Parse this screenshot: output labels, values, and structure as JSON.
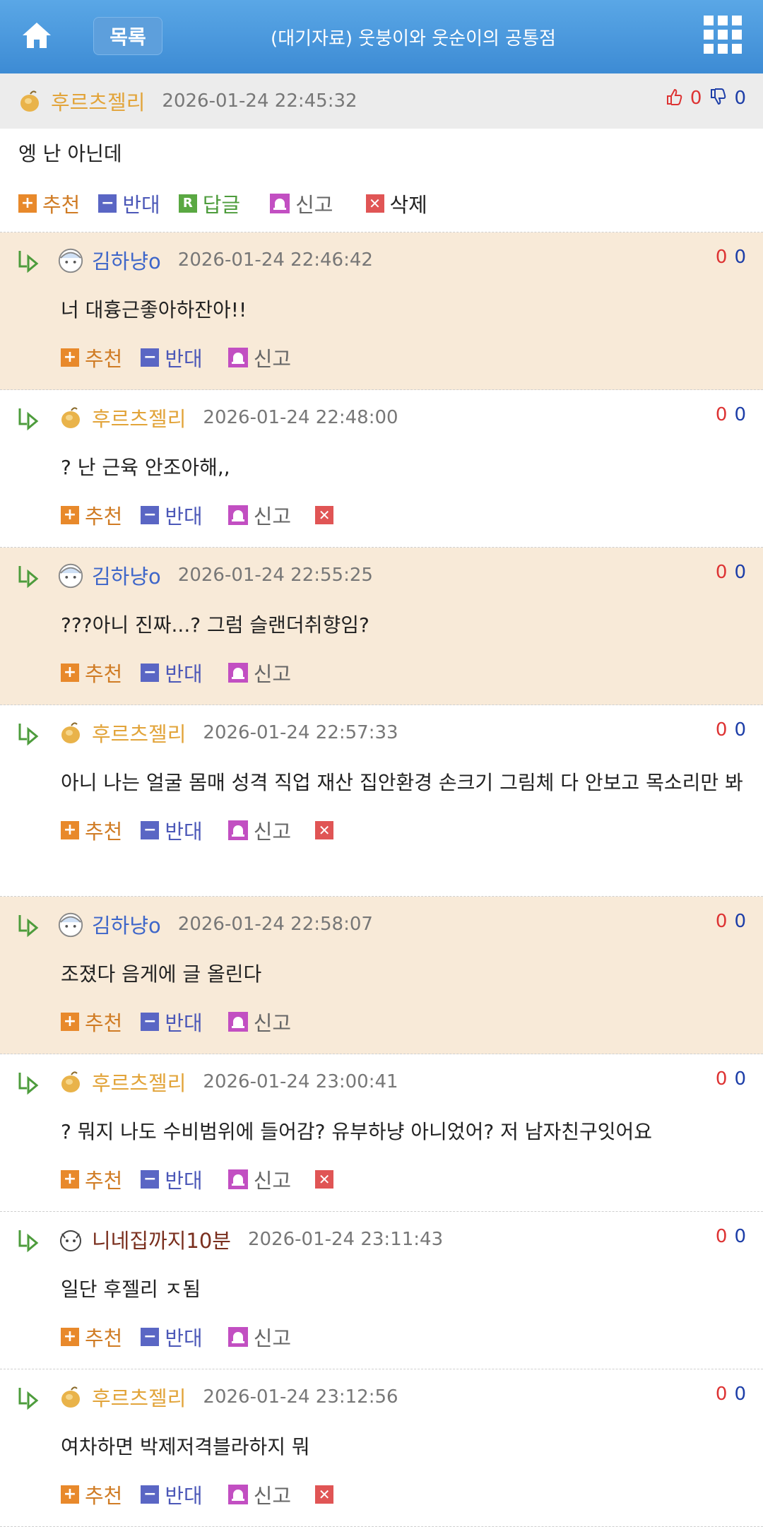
{
  "header": {
    "list_label": "목록",
    "title": "(대기자료) 웃붕이와 웃순이의 공통점"
  },
  "main_comment": {
    "nick": "후르츠젤리",
    "date": "2026-01-24 22:45:32",
    "up": "0",
    "down": "0",
    "text": "엥 난 아닌데",
    "actions": {
      "recommend": "추천",
      "oppose": "반대",
      "reply": "답글",
      "report": "신고",
      "delete": "삭제"
    }
  },
  "labels": {
    "recommend": "추천",
    "oppose": "반대",
    "report": "신고"
  },
  "replies": [
    {
      "nick": "김하냥o",
      "date": "2026-01-24 22:46:42",
      "up": "0",
      "down": "0",
      "text": "너 대흉근좋아하잔아!!"
    },
    {
      "nick": "후르츠젤리",
      "date": "2026-01-24 22:48:00",
      "up": "0",
      "down": "0",
      "text": "? 난 근육 안조아해,,"
    },
    {
      "nick": "김하냥o",
      "date": "2026-01-24 22:55:25",
      "up": "0",
      "down": "0",
      "text": "???아니 진짜...? 그럼 슬랜더취향임?"
    },
    {
      "nick": "후르츠젤리",
      "date": "2026-01-24 22:57:33",
      "up": "0",
      "down": "0",
      "text": "아니 나는 얼굴 몸매 성격 직업 재산 집안환경 손크기 그림체 다 안보고 목소리만 봐"
    },
    {
      "nick": "김하냥o",
      "date": "2026-01-24 22:58:07",
      "up": "0",
      "down": "0",
      "text": "조졌다 음게에 글 올린다"
    },
    {
      "nick": "후르츠젤리",
      "date": "2026-01-24 23:00:41",
      "up": "0",
      "down": "0",
      "text": "? 뭐지 나도 수비범위에 들어감? 유부하냥 아니었어? 저 남자친구잇어요"
    },
    {
      "nick": "니네집까지10분",
      "date": "2026-01-24 23:11:43",
      "up": "0",
      "down": "0",
      "text": "일단 후젤리 ㅈ됨"
    },
    {
      "nick": "후르츠젤리",
      "date": "2026-01-24 23:12:56",
      "up": "0",
      "down": "0",
      "text": "여차하면 박제저격블라하지 뭐"
    }
  ],
  "colors": {
    "header": "#3d8bd4",
    "alt_row": "#f8ead8",
    "recommend": "#e8892b",
    "oppose": "#5a66c4",
    "delete": "#e05555"
  }
}
